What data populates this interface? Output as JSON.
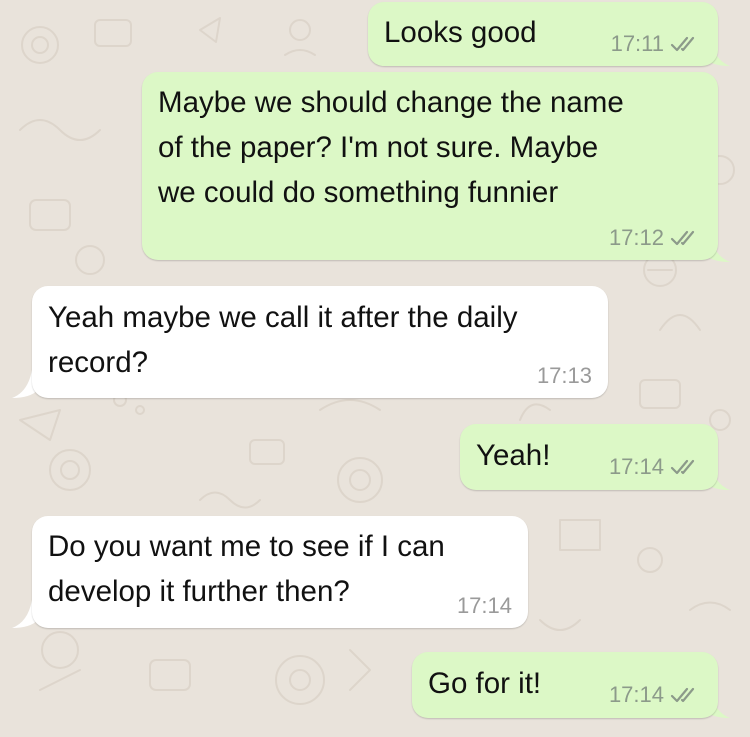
{
  "chat": {
    "messages": [
      {
        "direction": "outgoing",
        "text_lines": [
          "Looks good"
        ],
        "time": "17:11",
        "status_icon": "double-check-icon"
      },
      {
        "direction": "outgoing",
        "text_lines": [
          "Maybe we should change the name",
          "of the paper? I'm not sure. Maybe",
          "we could do something funnier"
        ],
        "time": "17:12",
        "status_icon": "double-check-icon"
      },
      {
        "direction": "incoming",
        "text_lines": [
          "Yeah maybe we call it after the daily",
          "record?"
        ],
        "time": "17:13"
      },
      {
        "direction": "outgoing",
        "text_lines": [
          "Yeah!"
        ],
        "time": "17:14",
        "status_icon": "double-check-icon"
      },
      {
        "direction": "incoming",
        "text_lines": [
          "Do you want me to see if I can",
          "develop it further then?"
        ],
        "time": "17:14"
      },
      {
        "direction": "outgoing",
        "text_lines": [
          "Go for it!"
        ],
        "time": "17:14",
        "status_icon": "double-check-icon"
      }
    ]
  },
  "colors": {
    "wallpaper": "#e9e3db",
    "outgoing_bubble": "#dcf8c6",
    "incoming_bubble": "#ffffff",
    "text": "#111111",
    "timestamp": "#8c9a8a",
    "read_ticks": "#8c9a8a"
  }
}
